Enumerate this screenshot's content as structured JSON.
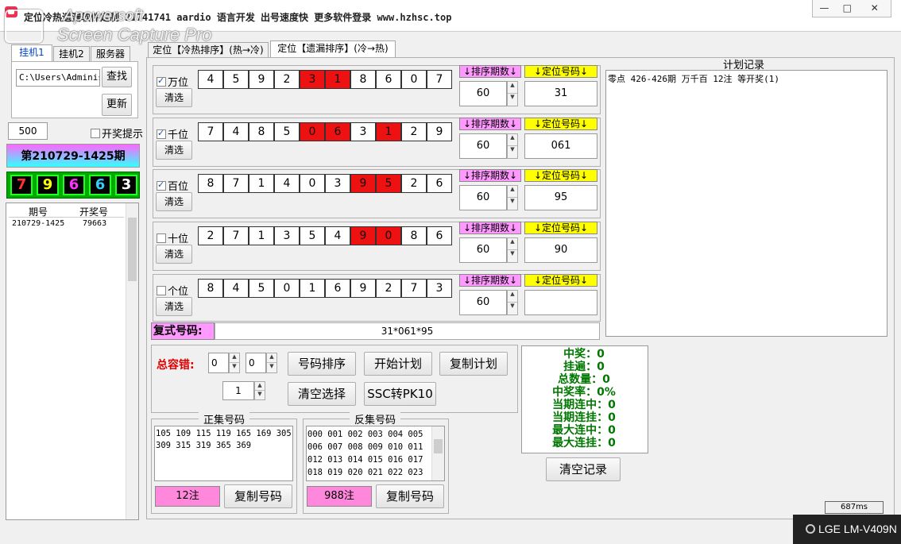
{
  "window": {
    "title": "定位冷热遗漏软件定制  21741741  aardio 语言开发  出号速度快  更多软件登录  www.hzhsc.top",
    "watermark_line1": "Apowersoft",
    "watermark_line2": "Screen Capture Pro",
    "minimize": "—",
    "maximize": "□",
    "close": "✕"
  },
  "left": {
    "tabs": [
      "挂机1",
      "挂机2",
      "服务器"
    ],
    "path_value": "C:\\Users\\Administ",
    "find_button": "查找",
    "refresh_button": "更新",
    "count_value": "500",
    "open_prompt_label": "开奖提示",
    "period_banner": "第210729-1425期",
    "result_digits": [
      {
        "value": "7",
        "color": "#ff3333"
      },
      {
        "value": "9",
        "color": "#ffff00"
      },
      {
        "value": "6",
        "color": "#ff33ff"
      },
      {
        "value": "6",
        "color": "#33ccff"
      },
      {
        "value": "3",
        "color": "#ffffff"
      }
    ],
    "list_headers": [
      "期号",
      "开奖号"
    ],
    "list_rows": [
      {
        "period": "210729-1425",
        "number": "79663"
      }
    ]
  },
  "main": {
    "tabs": [
      "定位【冷热排序】(热→冷)",
      "定位【遗漏排序】(冷→热)"
    ],
    "sort_period_label": "↓排序期数↓",
    "position_code_label": "↓定位号码↓",
    "clear_label": "清选",
    "rows": [
      {
        "label": "万位",
        "checked": true,
        "digits": [
          "4",
          "5",
          "9",
          "2",
          "3",
          "1",
          "8",
          "6",
          "0",
          "7"
        ],
        "hot": [
          4,
          5
        ],
        "period": "60",
        "code": "31"
      },
      {
        "label": "千位",
        "checked": true,
        "digits": [
          "7",
          "4",
          "8",
          "5",
          "0",
          "6",
          "3",
          "1",
          "2",
          "9"
        ],
        "hot": [
          4,
          5,
          7
        ],
        "period": "60",
        "code": "061"
      },
      {
        "label": "百位",
        "checked": true,
        "digits": [
          "8",
          "7",
          "1",
          "4",
          "0",
          "3",
          "9",
          "5",
          "2",
          "6"
        ],
        "hot": [
          6,
          7
        ],
        "period": "60",
        "code": "95"
      },
      {
        "label": "十位",
        "checked": false,
        "digits": [
          "2",
          "7",
          "1",
          "3",
          "5",
          "4",
          "9",
          "0",
          "8",
          "6"
        ],
        "hot": [
          6,
          7
        ],
        "period": "60",
        "code": "90"
      },
      {
        "label": "个位",
        "checked": false,
        "digits": [
          "8",
          "4",
          "5",
          "0",
          "1",
          "6",
          "9",
          "2",
          "7",
          "3"
        ],
        "hot": [],
        "period": "60",
        "code": ""
      }
    ],
    "compound_label": "复式号码:",
    "compound_value": "31*061*95",
    "plan_title": "计划记录",
    "plan_log": "零点 426-426期 万千百 12注  等开奖(1)"
  },
  "controls": {
    "tolerance_label": "总容错:",
    "spin1": "0",
    "spin2": "0",
    "spin3": "1",
    "sort_button": "号码排序",
    "start_plan_button": "开始计划",
    "copy_plan_button": "复制计划",
    "clear_select_button": "清空选择",
    "ssc_button": "SSC转PK10"
  },
  "stats": [
    "中奖：0",
    "挂遍：0",
    "总数量：0",
    "中奖率：0%",
    "当期连中：0",
    "当期连挂：0",
    "最大连中：0",
    "最大连挂：0"
  ],
  "clear_record_button": "清空记录",
  "positive": {
    "title": "正集号码",
    "lines": [
      "105 109 115 119 165 169 305",
      "309 315 319 365 369"
    ],
    "count": "12注",
    "copy_button": "复制号码"
  },
  "negative": {
    "title": "反集号码",
    "lines": [
      "000 001 002 003 004 005",
      "006 007 008 009 010 011",
      "012 013 014 015 016 017",
      "018 019 020 021 022 023"
    ],
    "count": "988注",
    "copy_button": "复制号码"
  },
  "status": {
    "timing": "687ms",
    "device": "LGE LM-V409N"
  }
}
